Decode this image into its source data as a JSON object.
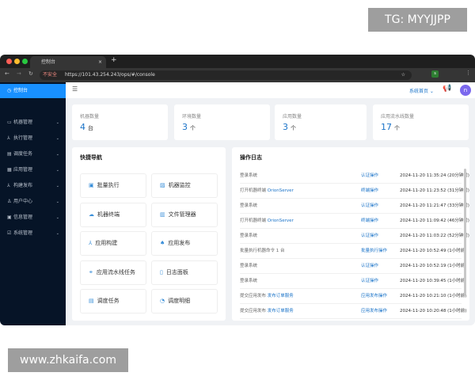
{
  "watermarks": {
    "top": "TG: MYYJJPP",
    "bottom": "www.zhkaifa.com"
  },
  "browser": {
    "tab_title": "控制台",
    "insecure_label": "不安全",
    "url": "https://101.43.254.243/ops/#/console",
    "profile_initial": "s"
  },
  "sidebar": {
    "items": [
      {
        "label": "控制台",
        "icon": "dashboard-icon",
        "active": true
      },
      {
        "label": "机器管理",
        "icon": "monitor-icon"
      },
      {
        "label": "执行管理",
        "icon": "cluster-icon"
      },
      {
        "label": "调度任务",
        "icon": "calendar-icon"
      },
      {
        "label": "应用管理",
        "icon": "app-icon"
      },
      {
        "label": "构建发布",
        "icon": "build-icon"
      },
      {
        "label": "用户中心",
        "icon": "user-icon"
      },
      {
        "label": "信息管理",
        "icon": "info-icon"
      },
      {
        "label": "系统管理",
        "icon": "settings-icon"
      }
    ]
  },
  "header": {
    "home_menu": "系统首页",
    "avatar_initial": "n"
  },
  "stats": [
    {
      "label": "机器数量",
      "value": "4",
      "unit": "台"
    },
    {
      "label": "环境数量",
      "value": "3",
      "unit": "个"
    },
    {
      "label": "应用数量",
      "value": "3",
      "unit": "个"
    },
    {
      "label": "应用流水线数量",
      "value": "17",
      "unit": "个"
    }
  ],
  "quick_nav": {
    "title": "快捷导航",
    "items": [
      {
        "label": "批量执行",
        "icon": "terminal-icon"
      },
      {
        "label": "机器监控",
        "icon": "chart-icon"
      },
      {
        "label": "机器终端",
        "icon": "cloud-icon"
      },
      {
        "label": "文件管理器",
        "icon": "folder-icon"
      },
      {
        "label": "应用构建",
        "icon": "build-icon"
      },
      {
        "label": "应用发布",
        "icon": "rocket-icon"
      },
      {
        "label": "应用流水线任务",
        "icon": "link-icon"
      },
      {
        "label": "日志面板",
        "icon": "log-icon"
      },
      {
        "label": "调度任务",
        "icon": "calendar-icon"
      },
      {
        "label": "调度明细",
        "icon": "gauge-icon"
      }
    ]
  },
  "op_log": {
    "title": "操作日志",
    "rows": [
      {
        "action": "登录系统",
        "target": "",
        "type": "认证操作",
        "time": "2024-11-20 11:35:24 (20分钟前)"
      },
      {
        "action": "打开机器终端",
        "target": "OrionServer",
        "type": "终端操作",
        "time": "2024-11-20 11:23:52 (31分钟前)"
      },
      {
        "action": "登录系统",
        "target": "",
        "type": "认证操作",
        "time": "2024-11-20 11:21:47 (33分钟前)"
      },
      {
        "action": "打开机器终端",
        "target": "OrionServer",
        "type": "终端操作",
        "time": "2024-11-20 11:09:42 (46分钟前)"
      },
      {
        "action": "登录系统",
        "target": "",
        "type": "认证操作",
        "time": "2024-11-20 11:03:22 (52分钟前)"
      },
      {
        "action": "批量执行机器命令 1 台",
        "target": "",
        "type": "批量执行操作",
        "time": "2024-11-20 10:52:49 (1小时前)"
      },
      {
        "action": "登录系统",
        "target": "",
        "type": "认证操作",
        "time": "2024-11-20 10:52:19 (1小时前)"
      },
      {
        "action": "登录系统",
        "target": "",
        "type": "认证操作",
        "time": "2024-11-20 10:39:45 (1小时前)"
      },
      {
        "action": "提交应用发布",
        "target": "发布订单服务",
        "type": "应用发布操作",
        "time": "2024-11-20 10:21:10 (1小时前)"
      },
      {
        "action": "提交应用发布",
        "target": "发布订单服务",
        "type": "应用发布操作",
        "time": "2024-11-20 10:20:48 (1小时前)"
      }
    ]
  },
  "colors": {
    "accent": "#1890ff",
    "sidebar_bg": "#061427",
    "link": "#1a73c8"
  }
}
